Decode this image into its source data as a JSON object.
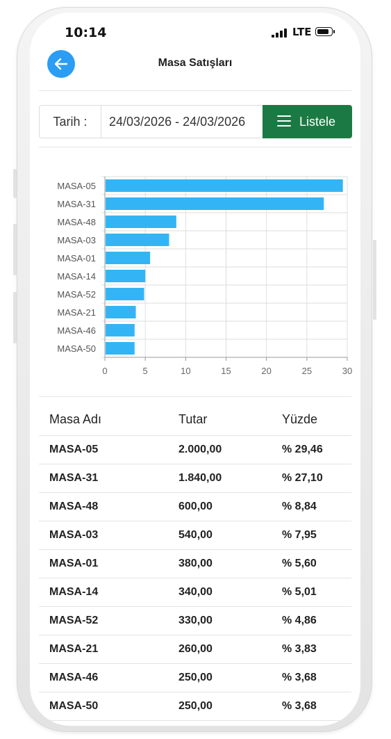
{
  "status_bar": {
    "time": "10:14",
    "network": "LTE"
  },
  "header": {
    "title": "Masa Satışları",
    "back_icon": "arrow-left-icon"
  },
  "filter": {
    "label": "Tarih :",
    "date_range": "24/03/2026 - 24/03/2026",
    "button_label": "Listele",
    "button_icon": "menu-icon",
    "button_color": "#1b7a43"
  },
  "chart_data": {
    "type": "bar",
    "orientation": "horizontal",
    "categories": [
      "MASA-05",
      "MASA-31",
      "MASA-48",
      "MASA-03",
      "MASA-01",
      "MASA-14",
      "MASA-52",
      "MASA-21",
      "MASA-46",
      "MASA-50"
    ],
    "values": [
      29.46,
      27.1,
      8.84,
      7.95,
      5.6,
      5.01,
      4.86,
      3.83,
      3.68,
      3.68
    ],
    "xlim": [
      0,
      30
    ],
    "xticks": [
      "0",
      "5",
      "10",
      "15",
      "20",
      "25",
      "30"
    ],
    "grid": true,
    "color": "#33b5f5"
  },
  "table": {
    "headers": [
      "Masa Adı",
      "Tutar",
      "Yüzde"
    ],
    "rows": [
      [
        "MASA-05",
        "2.000,00",
        "% 29,46"
      ],
      [
        "MASA-31",
        "1.840,00",
        "% 27,10"
      ],
      [
        "MASA-48",
        "600,00",
        "% 8,84"
      ],
      [
        "MASA-03",
        "540,00",
        "% 7,95"
      ],
      [
        "MASA-01",
        "380,00",
        "% 5,60"
      ],
      [
        "MASA-14",
        "340,00",
        "% 5,01"
      ],
      [
        "MASA-52",
        "330,00",
        "% 4,86"
      ],
      [
        "MASA-21",
        "260,00",
        "% 3,83"
      ],
      [
        "MASA-46",
        "250,00",
        "% 3,68"
      ],
      [
        "MASA-50",
        "250,00",
        "% 3,68"
      ]
    ]
  }
}
